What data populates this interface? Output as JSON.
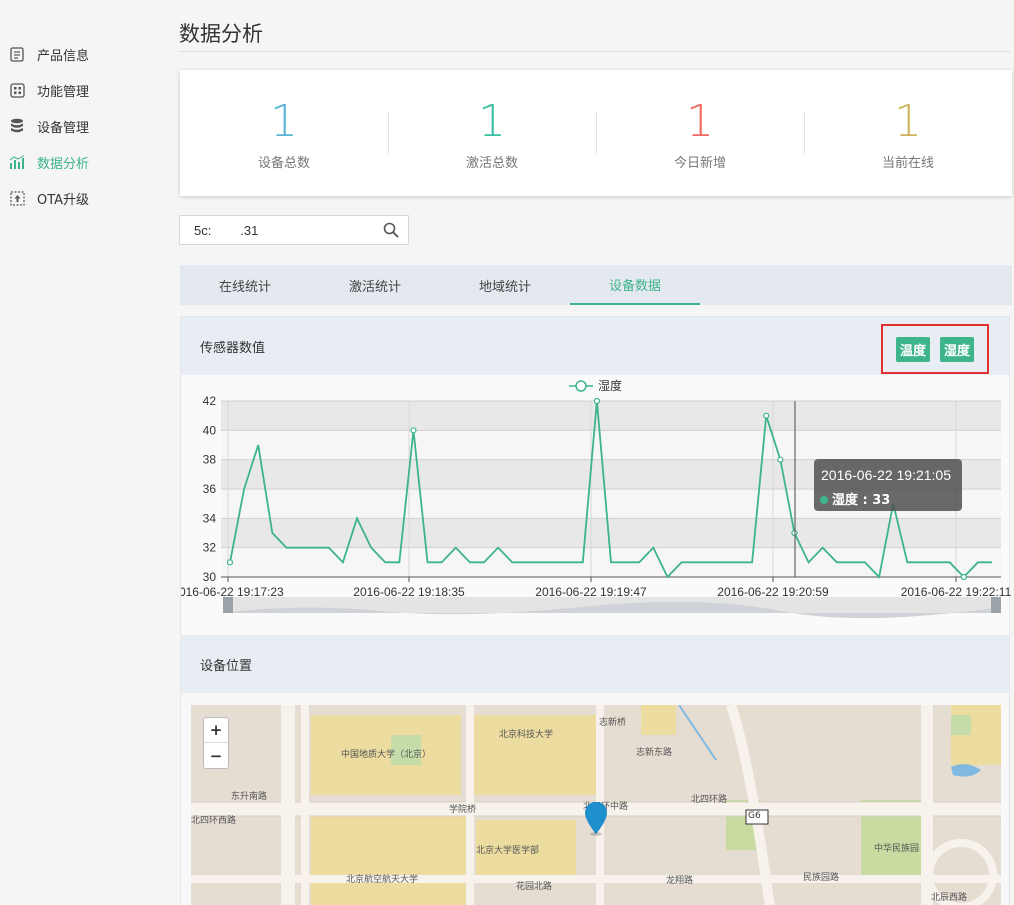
{
  "sidebar": {
    "items": [
      {
        "label": "产品信息",
        "icon": "document-icon"
      },
      {
        "label": "功能管理",
        "icon": "grid-icon"
      },
      {
        "label": "设备管理",
        "icon": "database-icon"
      },
      {
        "label": "数据分析",
        "icon": "bar-chart-icon",
        "active": true
      },
      {
        "label": "OTA升级",
        "icon": "upload-icon"
      }
    ]
  },
  "header": {
    "title": "数据分析"
  },
  "stats": [
    {
      "value": "1",
      "label": "设备总数",
      "color": "#5ab4d6"
    },
    {
      "value": "1",
      "label": "激活总数",
      "color": "#3cbfa3"
    },
    {
      "value": "1",
      "label": "今日新增",
      "color": "#ef6a5e"
    },
    {
      "value": "1",
      "label": "当前在线",
      "color": "#cdb35a"
    }
  ],
  "search": {
    "value": "5c:        .31",
    "icon": "search-icon"
  },
  "tabs": [
    {
      "label": "在线统计"
    },
    {
      "label": "激活统计"
    },
    {
      "label": "地域统计"
    },
    {
      "label": "设备数据",
      "active": true
    }
  ],
  "sensor_panel": {
    "title": "传感器数值",
    "buttons": [
      "温度",
      "湿度"
    ]
  },
  "location_panel": {
    "title": "设备位置"
  },
  "chart_data": {
    "type": "line",
    "legend": "湿度",
    "ylim": [
      30,
      42
    ],
    "yticks": [
      30,
      32,
      34,
      36,
      38,
      40,
      42
    ],
    "xticks": [
      "2016-06-22 19:17:23",
      "2016-06-22 19:18:35",
      "2016-06-22 19:19:47",
      "2016-06-22 19:20:59",
      "2016-06-22 19:22:11"
    ],
    "series": [
      {
        "name": "湿度",
        "values": [
          31,
          36,
          39,
          33,
          32,
          32,
          32,
          32,
          31,
          34,
          32,
          31,
          31,
          40,
          31,
          31,
          32,
          31,
          31,
          32,
          31,
          31,
          31,
          31,
          31,
          31,
          42,
          31,
          31,
          31,
          32,
          30,
          31,
          31,
          31,
          31,
          31,
          31,
          41,
          38,
          33,
          31,
          32,
          31,
          31,
          31,
          30,
          35,
          31,
          31,
          31,
          31,
          30,
          31,
          31
        ]
      }
    ],
    "tooltip": {
      "time": "2016-06-22 19:21:05",
      "label": "湿度 : 33"
    },
    "grid": true,
    "colors": {
      "line": "#3db48a"
    }
  },
  "map": {
    "zoom_in": "+",
    "zoom_out": "−",
    "labels": [
      "中国地质大学（北京）",
      "北京科技大学",
      "北四环中路",
      "北四环西路",
      "学院桥",
      "北京大学医学部",
      "北京航空航天大学",
      "花园北路",
      "龙翔路",
      "民族园路",
      "中华民族园",
      "北辰西路",
      "东升南路",
      "G6",
      "志新东路",
      "北四环路",
      "志新桥"
    ]
  }
}
